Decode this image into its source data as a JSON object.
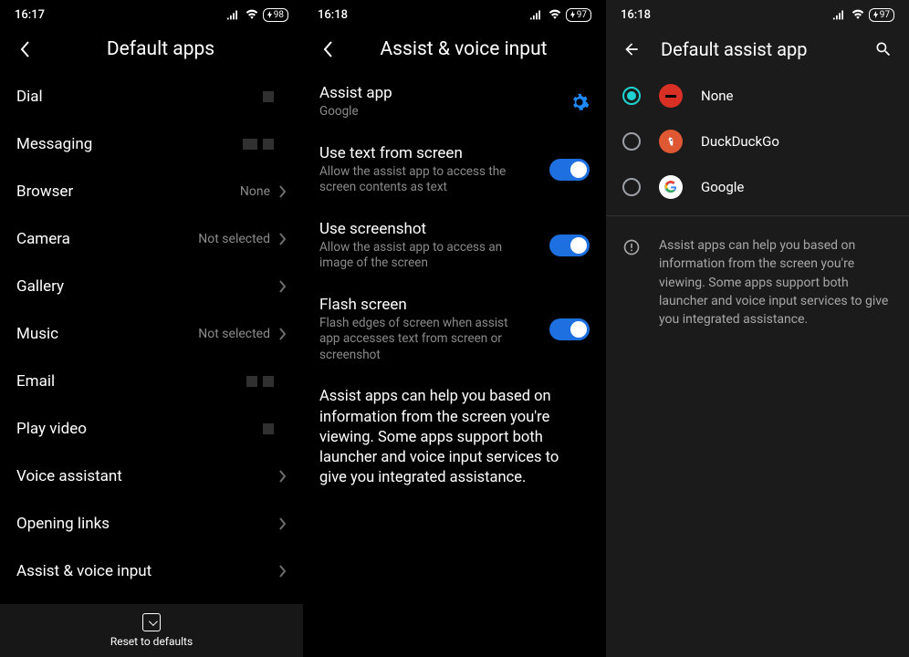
{
  "status": {
    "time1": "16:17",
    "time2": "16:18",
    "time3": "16:18",
    "battery1": "98",
    "battery2": "97",
    "battery3": "97"
  },
  "screen1": {
    "title": "Default apps",
    "items": {
      "dial": "Dial",
      "messaging": "Messaging",
      "browser": "Browser",
      "browser_val": "None",
      "camera": "Camera",
      "camera_val": "Not selected",
      "gallery": "Gallery",
      "music": "Music",
      "music_val": "Not selected",
      "email": "Email",
      "playvideo": "Play video",
      "voice_assistant": "Voice assistant",
      "opening_links": "Opening links",
      "assist_voice": "Assist & voice input"
    },
    "footer": "Reset to defaults"
  },
  "screen2": {
    "title": "Assist & voice input",
    "assist_app": "Assist app",
    "assist_app_sub": "Google",
    "use_text": "Use text from screen",
    "use_text_sub": "Allow the assist app to access the screen contents as text",
    "use_shot": "Use screenshot",
    "use_shot_sub": "Allow the assist app to access an image of the screen",
    "flash": "Flash screen",
    "flash_sub": "Flash edges of screen when assist app accesses text from screen or screenshot",
    "info": "Assist apps can help you based on information from the screen you're viewing. Some apps support both launcher and voice input services to give you integrated assistance."
  },
  "screen3": {
    "title": "Default assist app",
    "none": "None",
    "ddg": "DuckDuckGo",
    "google": "Google",
    "info": "Assist apps can help you based on information from the screen you're viewing. Some apps support both launcher and voice input services to give you integrated assistance."
  }
}
